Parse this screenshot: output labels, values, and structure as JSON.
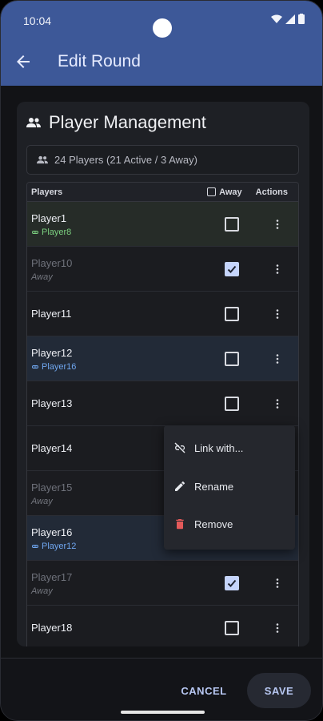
{
  "status_bar": {
    "time": "10:04"
  },
  "app_bar": {
    "title": "Edit Round"
  },
  "section": {
    "title": "Player Management",
    "summary": "24 Players (21 Active / 3 Away)"
  },
  "table": {
    "headers": {
      "players": "Players",
      "away": "Away",
      "actions": "Actions"
    },
    "rows": [
      {
        "name": "Player1",
        "sub": "Player8",
        "away": false
      },
      {
        "name": "Player10",
        "sub": "Away",
        "away": true
      },
      {
        "name": "Player11",
        "sub": "",
        "away": false
      },
      {
        "name": "Player12",
        "sub": "Player16",
        "away": false
      },
      {
        "name": "Player13",
        "sub": "",
        "away": false
      },
      {
        "name": "Player14",
        "sub": "",
        "away": false
      },
      {
        "name": "Player15",
        "sub": "Away",
        "away": true
      },
      {
        "name": "Player16",
        "sub": "Player12",
        "away": false
      },
      {
        "name": "Player17",
        "sub": "Away",
        "away": true
      },
      {
        "name": "Player18",
        "sub": "",
        "away": false
      }
    ]
  },
  "context_menu": {
    "items": [
      {
        "label": "Link with...",
        "icon": "link-off-icon"
      },
      {
        "label": "Rename",
        "icon": "pencil-icon"
      },
      {
        "label": "Remove",
        "icon": "trash-icon"
      }
    ]
  },
  "actions": {
    "cancel": "CANCEL",
    "save": "SAVE"
  },
  "colors": {
    "app_bar": "#3d5898",
    "link_green": "#7bcf7f",
    "link_blue": "#6fa6ef",
    "remove_red": "#e45a5a",
    "checkbox_checked": "#c5d4fb"
  }
}
